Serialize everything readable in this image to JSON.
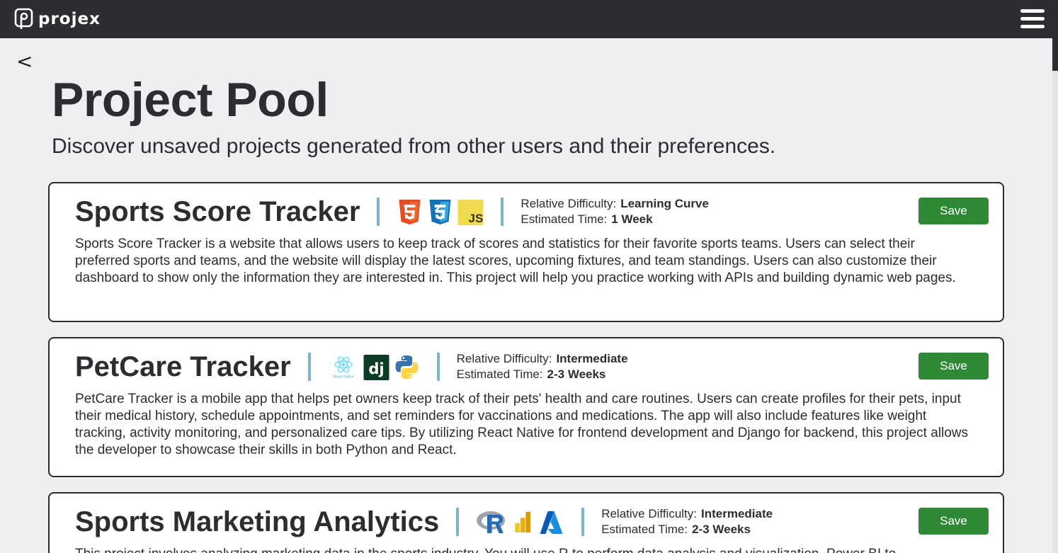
{
  "app": {
    "name": "projex"
  },
  "nav": {
    "back_label": "<"
  },
  "page": {
    "title": "Project Pool",
    "subtitle": "Discover unsaved projects generated from other users and their preferences."
  },
  "labels": {
    "difficulty": "Relative Difficulty:",
    "time": "Estimated Time:",
    "save": "Save"
  },
  "projects": [
    {
      "title": "Sports Score Tracker",
      "stack": [
        "html5-icon",
        "css3-icon",
        "javascript-icon"
      ],
      "difficulty": "Learning Curve",
      "time": "1 Week",
      "description": "Sports Score Tracker is a website that allows users to keep track of scores and statistics for their favorite sports teams. Users can select their preferred sports and teams, and the website will display the latest scores, upcoming fixtures, and team standings. Users can also customize their dashboard to show only the information they are interested in. This project will help you practice working with APIs and building dynamic web pages."
    },
    {
      "title": "PetCare Tracker",
      "stack": [
        "react-native-icon",
        "django-icon",
        "python-icon"
      ],
      "stack_text": {
        "react_native": "React Native",
        "django": "dj"
      },
      "difficulty": "Intermediate",
      "time": "2-3 Weeks",
      "description": "PetCare Tracker is a mobile app that helps pet owners keep track of their pets' health and care routines. Users can create profiles for their pets, input their medical history, schedule appointments, and set reminders for vaccinations and medications. The app will also include features like weight tracking, activity monitoring, and personalized care tips. By utilizing React Native for frontend development and Django for backend, this project allows the developer to showcase their skills in both Python and React."
    },
    {
      "title": "Sports Marketing Analytics",
      "stack": [
        "r-icon",
        "power-bi-icon",
        "azure-icon"
      ],
      "difficulty": "Intermediate",
      "time": "2-3 Weeks",
      "description": "This project involves analyzing marketing data in the sports industry. You will use R to perform data analysis and visualization. Power BI to"
    }
  ],
  "colors": {
    "topbar": "#2d2e31",
    "background": "#eeeff1",
    "save_button": "#2f8a38",
    "separator": "#7fb6c7"
  }
}
